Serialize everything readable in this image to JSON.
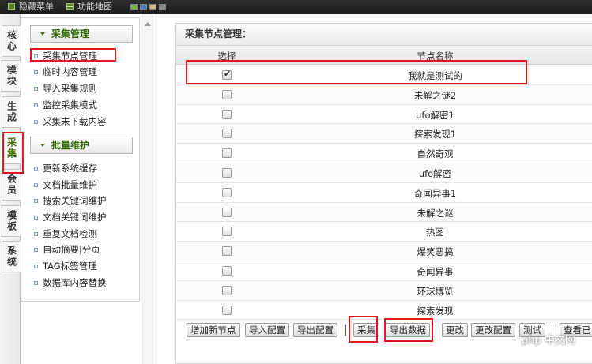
{
  "topbar": {
    "hide_menu": "隐藏菜单",
    "site_map": "功能地图",
    "themes": [
      "#7db33f",
      "#4a7fc1",
      "#c9b98a",
      "#8a8a8a"
    ]
  },
  "vtabs": [
    {
      "label": "核心"
    },
    {
      "label": "模块"
    },
    {
      "label": "生成"
    },
    {
      "label": "采集",
      "active": true
    },
    {
      "label": "会员"
    },
    {
      "label": "模板"
    },
    {
      "label": "系统"
    }
  ],
  "sidemenu": {
    "group1": {
      "title": "采集管理",
      "items": [
        "采集节点管理",
        "临时内容管理",
        "导入采集规则",
        "监控采集模式",
        "采集未下载内容"
      ]
    },
    "group2": {
      "title": "批量维护",
      "items": [
        "更新系统缓存",
        "文档批量维护",
        "搜索关键词维护",
        "文档关键词维护",
        "重复文档检测",
        "自动摘要|分页",
        "TAG标签管理",
        "数据库内容替换"
      ]
    }
  },
  "panel": {
    "title": "采集节点管理：",
    "columns": {
      "select": "选择",
      "name": "节点名称"
    },
    "rows": [
      {
        "name": "我就是测试的",
        "checked": true
      },
      {
        "name": "未解之谜2",
        "checked": false
      },
      {
        "name": "ufo解密1",
        "checked": false
      },
      {
        "name": "探索发现1",
        "checked": false
      },
      {
        "name": "自然奇观",
        "checked": false
      },
      {
        "name": "ufo解密",
        "checked": false
      },
      {
        "name": "奇闻异事1",
        "checked": false
      },
      {
        "name": "未解之谜",
        "checked": false
      },
      {
        "name": "热图",
        "checked": false
      },
      {
        "name": "爆笑恶搞",
        "checked": false
      },
      {
        "name": "奇闻异事",
        "checked": false
      },
      {
        "name": "环球博览",
        "checked": false
      },
      {
        "name": "探索发现",
        "checked": false
      }
    ],
    "buttons": {
      "add_node": "增加新节点",
      "import_config": "导入配置",
      "export_config": "导出配置",
      "collect": "采集",
      "export_data": "导出数据",
      "change": "更改",
      "change_config": "更改配置",
      "test": "测试",
      "view": "查看已"
    }
  },
  "watermark": "php 中文网",
  "annotation_color": "#e0171f"
}
